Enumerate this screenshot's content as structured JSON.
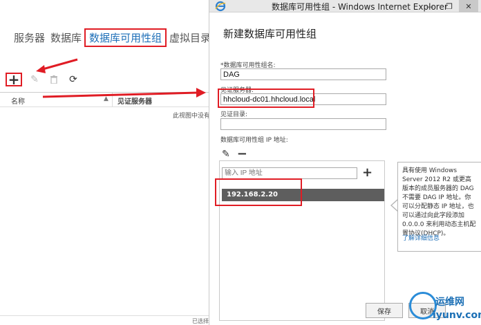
{
  "background_page": {
    "nav_tabs": [
      {
        "label": "服务器",
        "active": false
      },
      {
        "label": "数据库",
        "active": false
      },
      {
        "label": "数据库可用性组",
        "active": true
      },
      {
        "label": "虚拟目录",
        "active": false
      }
    ],
    "toolbar": {
      "add_icon": "+",
      "edit_icon": "✎",
      "delete_icon": "🗑",
      "refresh_icon": "⟳"
    },
    "grid": {
      "col_name": "名称",
      "col_witness": "见证服务器"
    },
    "empty_message": "此视图中没有",
    "status_text": "已选择"
  },
  "ie_window": {
    "title": "数据库可用性组 - Windows Internet Explorer",
    "heading": "新建数据库可用性组",
    "dag_name_label": "*数据库可用性组名:",
    "dag_name_value": "DAG",
    "witness_server_label": "见证服务器:",
    "witness_server_value": "hhcloud-dc01.hhcloud.local",
    "witness_dir_label": "见证目录:",
    "witness_dir_value": "",
    "ip_label": "数据库可用性组 IP 地址:",
    "ip_placeholder": "输入 IP 地址",
    "ip_entries": [
      "192.168.2.20"
    ],
    "save_label": "保存",
    "cancel_label": "取消"
  },
  "tooltip": {
    "text": "具有使用 Windows Server 2012 R2 或更高版本的成员服务器的 DAG 不需要 DAG IP 地址。你可以分配静态 IP 地址，也可以通过向此字段添加 0.0.0.0 来利用动态主机配置协议(DHCP)。",
    "link": "了解详细信息"
  },
  "watermark": {
    "line1": "运维网",
    "line2": "iyunv.com"
  },
  "colors": {
    "annotation_red": "#e01c24",
    "link_blue": "#1e6fb8",
    "ip_row_bg": "#5e5e5e"
  }
}
